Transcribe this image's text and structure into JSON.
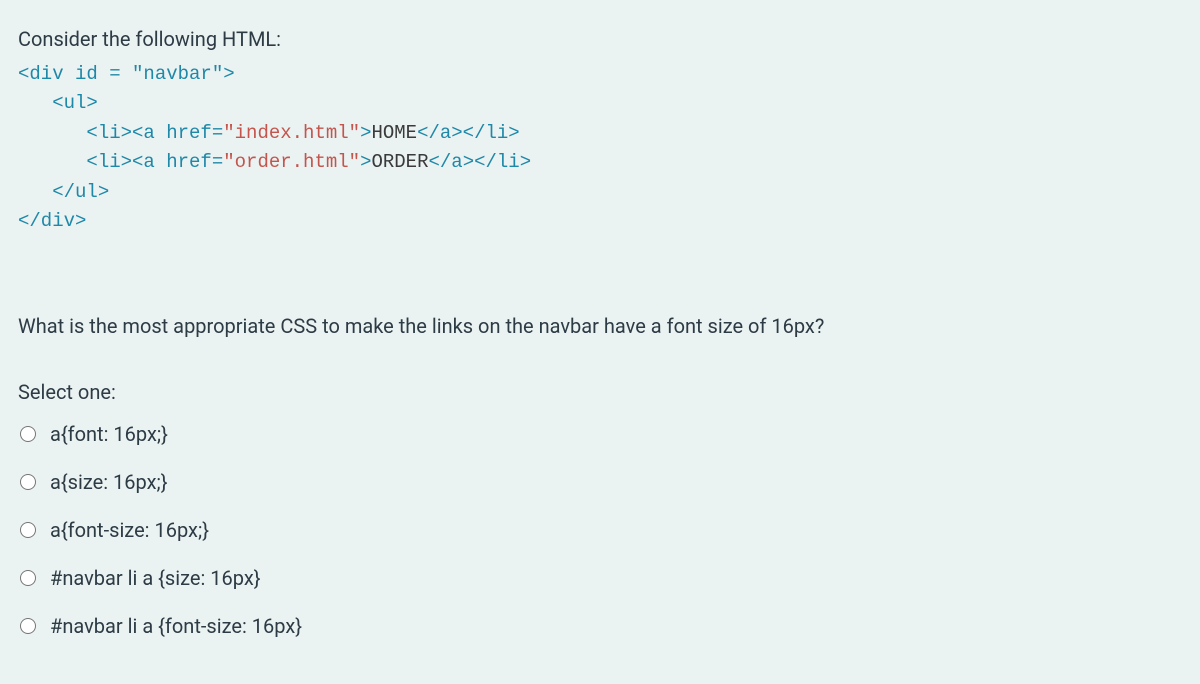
{
  "intro": "Consider the following HTML:",
  "code": {
    "l1": "<div id = \"navbar\">",
    "l2": "   <ul>",
    "l3a": "      <li><a href=",
    "l3b": "\"index.html\"",
    "l3c": ">",
    "l3d": "HOME",
    "l3e": "</a></li>",
    "l4a": "      <li><a href=",
    "l4b": "\"order.html\"",
    "l4c": ">",
    "l4d": "ORDER",
    "l4e": "</a></li>",
    "l5": "   </ul>",
    "l6": "</div>"
  },
  "question": "What is the most appropriate CSS to make the links on the navbar have a font size of 16px?",
  "select_label": "Select one:",
  "options": [
    "a{font: 16px;}",
    "a{size: 16px;}",
    "a{font-size: 16px;}",
    "#navbar li a {size: 16px}",
    "#navbar li a {font-size: 16px}"
  ]
}
